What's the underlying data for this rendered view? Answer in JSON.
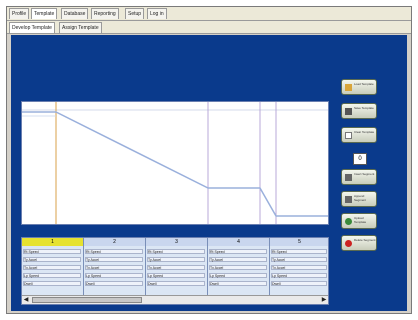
{
  "menu": [
    "Profile",
    "Template",
    "Database",
    "Reporting",
    "Setup",
    "Log in"
  ],
  "subtabs": [
    "Develop Template",
    "Assign Template"
  ],
  "side_buttons": [
    {
      "name": "load-button",
      "label": "Load Template",
      "icon": "folder-icon",
      "color": "#d9a53a"
    },
    {
      "name": "save-button",
      "label": "Save Template",
      "icon": "disk-icon",
      "color": "#555555"
    },
    {
      "name": "clear-button",
      "label": "Clear Template",
      "icon": "page-icon",
      "color": "#ffffff"
    },
    {
      "name": "insert-button",
      "label": "Insert Segment",
      "icon": "insert-icon",
      "color": "#666666"
    },
    {
      "name": "append-button",
      "label": "Append Segment",
      "icon": "append-icon",
      "color": "#666666"
    },
    {
      "name": "upload-button",
      "label": "Upload Template",
      "icon": "upload-icon",
      "color": "#3a8a3a"
    },
    {
      "name": "delete-button",
      "label": "Delete Segment",
      "icon": "delete-icon",
      "color": "#cc2222"
    }
  ],
  "counter": "0",
  "segments": [
    "1",
    "2",
    "3",
    "4",
    "5"
  ],
  "row_labels": [
    "Rt Speed",
    "Ty Accel",
    "Tx Accel",
    "Lp Speed",
    "Dwell"
  ],
  "scroll": {
    "left": "◀",
    "right": "▶"
  }
}
